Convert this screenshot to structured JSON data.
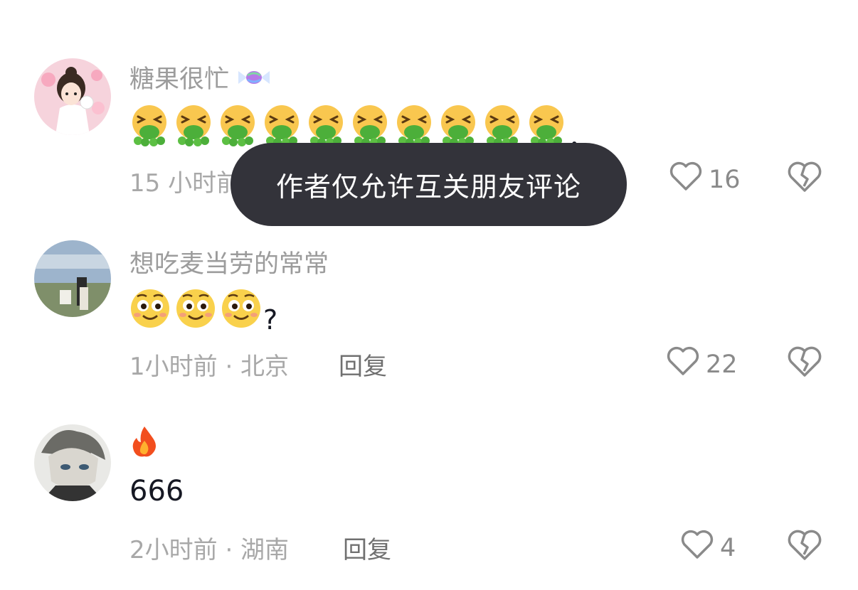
{
  "comments": [
    {
      "username": "糖果很忙",
      "username_icon": "candy-icon",
      "emoji": "nauseated-face-emoji",
      "emoji_count": 10,
      "text_suffix": "，",
      "meta": "15 小时前",
      "likes": "16"
    },
    {
      "username": "想吃麦当劳的常常",
      "emoji": "smiley-face-emoji",
      "emoji_count": 3,
      "text_suffix": "?",
      "meta": "1小时前 · 北京",
      "reply": "回复",
      "likes": "22"
    },
    {
      "username_icon": "fire-icon",
      "text": "666",
      "meta": "2小时前 · 湖南",
      "reply": "回复",
      "likes": "4"
    }
  ],
  "toast": {
    "text": "作者仅允许互关朋友评论"
  },
  "colors": {
    "toast_bg": "#33333a",
    "meta": "#a8a8a8",
    "username": "#9c9c9c",
    "text": "#161823"
  }
}
